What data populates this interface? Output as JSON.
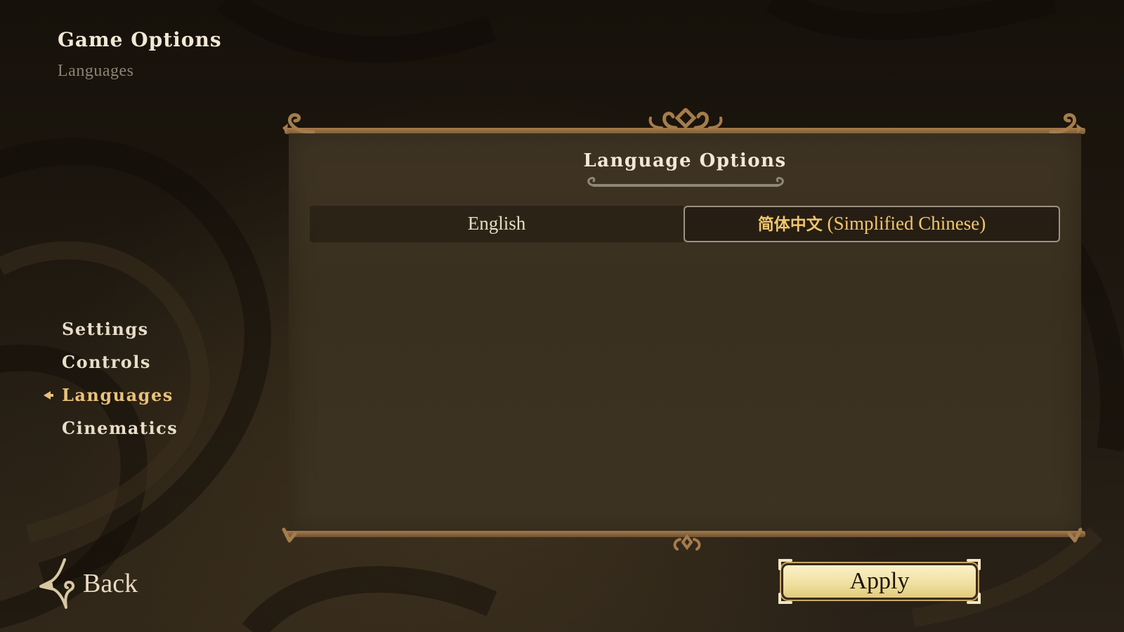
{
  "header": {
    "title": "Game Options",
    "subtitle": "Languages"
  },
  "sidebar": {
    "items": [
      {
        "label": "Settings",
        "active": false
      },
      {
        "label": "Controls",
        "active": false
      },
      {
        "label": "Languages",
        "active": true
      },
      {
        "label": "Cinematics",
        "active": false
      }
    ]
  },
  "panel": {
    "title": "Language Options",
    "options": {
      "english": "English",
      "chinese_native": "简体中文",
      "chinese_english": "(Simplified Chinese)"
    },
    "selected": "chinese"
  },
  "footer": {
    "back_label": "Back",
    "apply_label": "Apply"
  },
  "colors": {
    "accent": "#e9c17a",
    "selected_text": "#f2c66c",
    "frame": "#a57c4c",
    "button_face": "#f5e7b3"
  }
}
